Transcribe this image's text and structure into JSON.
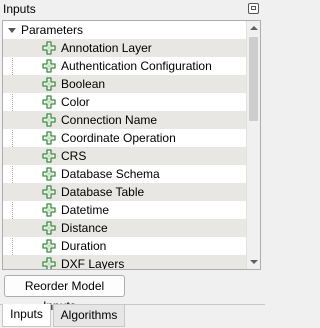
{
  "panel": {
    "title": "Inputs"
  },
  "tree": {
    "root_label": "Parameters",
    "items": [
      "Annotation Layer",
      "Authentication Configuration",
      "Boolean",
      "Color",
      "Connection Name",
      "Coordinate Operation",
      "CRS",
      "Database Schema",
      "Database Table",
      "Datetime",
      "Distance",
      "Duration",
      "DXF Layers"
    ]
  },
  "buttons": {
    "reorder_label": "Reorder Model Inputs..."
  },
  "tabs": [
    {
      "label": "Inputs",
      "active": true
    },
    {
      "label": "Algorithms",
      "active": false
    }
  ],
  "colors": {
    "plus_icon": "#3c8a3c",
    "alt_row": "#e9e7e3"
  }
}
